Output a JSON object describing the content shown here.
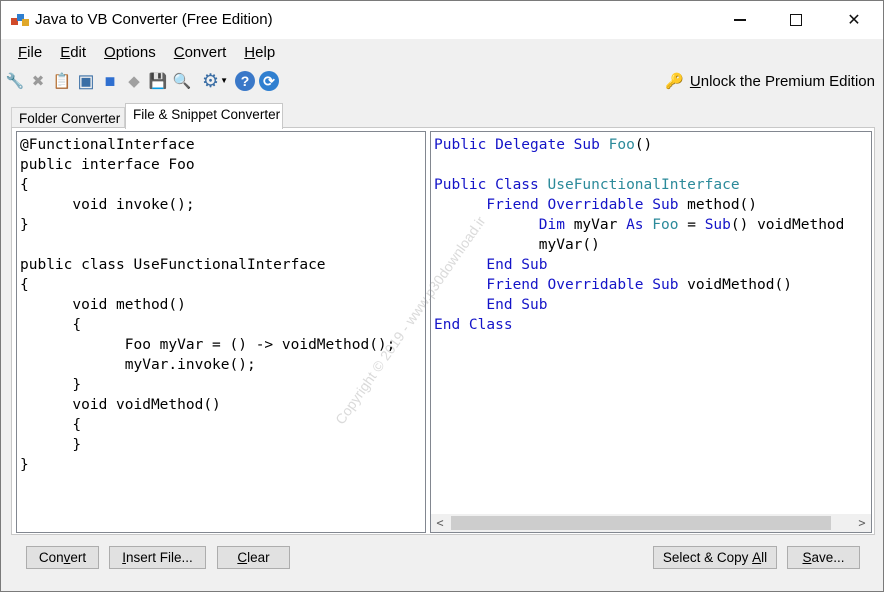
{
  "window": {
    "title": "Java to VB Converter (Free Edition)",
    "controls": {
      "minimize": "–",
      "close": "✕"
    }
  },
  "menu": [
    {
      "mnemonic": "F",
      "rest": "ile"
    },
    {
      "mnemonic": "E",
      "rest": "dit"
    },
    {
      "mnemonic": "O",
      "rest": "ptions"
    },
    {
      "mnemonic": "C",
      "rest": "onvert"
    },
    {
      "mnemonic": "H",
      "rest": "elp"
    }
  ],
  "toolbar": {
    "icons": [
      {
        "name": "wrench-icon",
        "glyph": "🔧",
        "color": "#c0392b"
      },
      {
        "name": "delete-icon",
        "glyph": "✖",
        "color": "#9a9a9a"
      },
      {
        "name": "paste-icon",
        "glyph": "📋",
        "color": "#b07a2a"
      },
      {
        "name": "window-icon",
        "glyph": "▣",
        "color": "#3a6ea5"
      },
      {
        "name": "select-all-icon",
        "glyph": "■",
        "color": "#2f6fd0"
      },
      {
        "name": "eraser-icon",
        "glyph": "◆",
        "color": "#a0a0a0"
      },
      {
        "name": "save-icon",
        "glyph": "💾",
        "color": "#2a4a8a"
      },
      {
        "name": "search-icon",
        "glyph": "🔍",
        "color": "#3a6ea5"
      },
      {
        "name": "gear-icon",
        "glyph": "⚙",
        "color": "#3a6ea5"
      },
      {
        "name": "help-icon",
        "glyph": "?",
        "color": "#ffffff"
      },
      {
        "name": "refresh-icon",
        "glyph": "⟳",
        "color": "#ffffff"
      }
    ],
    "unlock": {
      "mnemonic": "U",
      "rest": "nlock the Premium Edition"
    }
  },
  "tabs": [
    "Folder Converter",
    "File & Snippet Converter"
  ],
  "java_code": [
    "@FunctionalInterface",
    "public interface Foo",
    "{",
    "\tvoid invoke();",
    "}",
    "",
    "public class UseFunctionalInterface",
    "{",
    "\tvoid method()",
    "\t{",
    "\t\tFoo myVar = () -> voidMethod();",
    "\t\tmyVar.invoke();",
    "\t}",
    "\tvoid voidMethod()",
    "\t{",
    "\t}",
    "}"
  ],
  "vb_code": [
    [
      {
        "t": "Public Delegate Sub ",
        "c": "kw"
      },
      {
        "t": "Foo",
        "c": "ty"
      },
      {
        "t": "()",
        "c": ""
      }
    ],
    [],
    [
      {
        "t": "Public Class ",
        "c": "kw"
      },
      {
        "t": "UseFunctionalInterface",
        "c": "ty"
      }
    ],
    [
      {
        "t": "\tFriend Overridable Sub ",
        "c": "kw"
      },
      {
        "t": "method()",
        "c": ""
      }
    ],
    [
      {
        "t": "\t\tDim ",
        "c": "kw"
      },
      {
        "t": "myVar ",
        "c": ""
      },
      {
        "t": "As ",
        "c": "kw"
      },
      {
        "t": "Foo",
        "c": "ty"
      },
      {
        "t": " = ",
        "c": ""
      },
      {
        "t": "Sub",
        "c": "kw"
      },
      {
        "t": "() voidMethod",
        "c": ""
      }
    ],
    [
      {
        "t": "\t\tmyVar()",
        "c": ""
      }
    ],
    [
      {
        "t": "\tEnd Sub",
        "c": "kw"
      }
    ],
    [
      {
        "t": "\tFriend Overridable Sub ",
        "c": "kw"
      },
      {
        "t": "voidMethod()",
        "c": ""
      }
    ],
    [
      {
        "t": "\tEnd Sub",
        "c": "kw"
      }
    ],
    [
      {
        "t": "End Class",
        "c": "kw"
      }
    ]
  ],
  "watermark": "Copyright © 2019 - www.p30download.ir",
  "buttons": {
    "convert": {
      "pre": "Con",
      "mnemonic": "v",
      "post": "ert"
    },
    "insert_file": {
      "pre": "",
      "mnemonic": "I",
      "post": "nsert File..."
    },
    "clear": {
      "pre": "",
      "mnemonic": "C",
      "post": "lear"
    },
    "select_copy": {
      "pre": "Select & Copy ",
      "mnemonic": "A",
      "post": "ll"
    },
    "save": {
      "pre": "",
      "mnemonic": "S",
      "post": "ave..."
    }
  },
  "colors": {
    "keyword": "#1414c8",
    "type": "#2b8a9a"
  }
}
